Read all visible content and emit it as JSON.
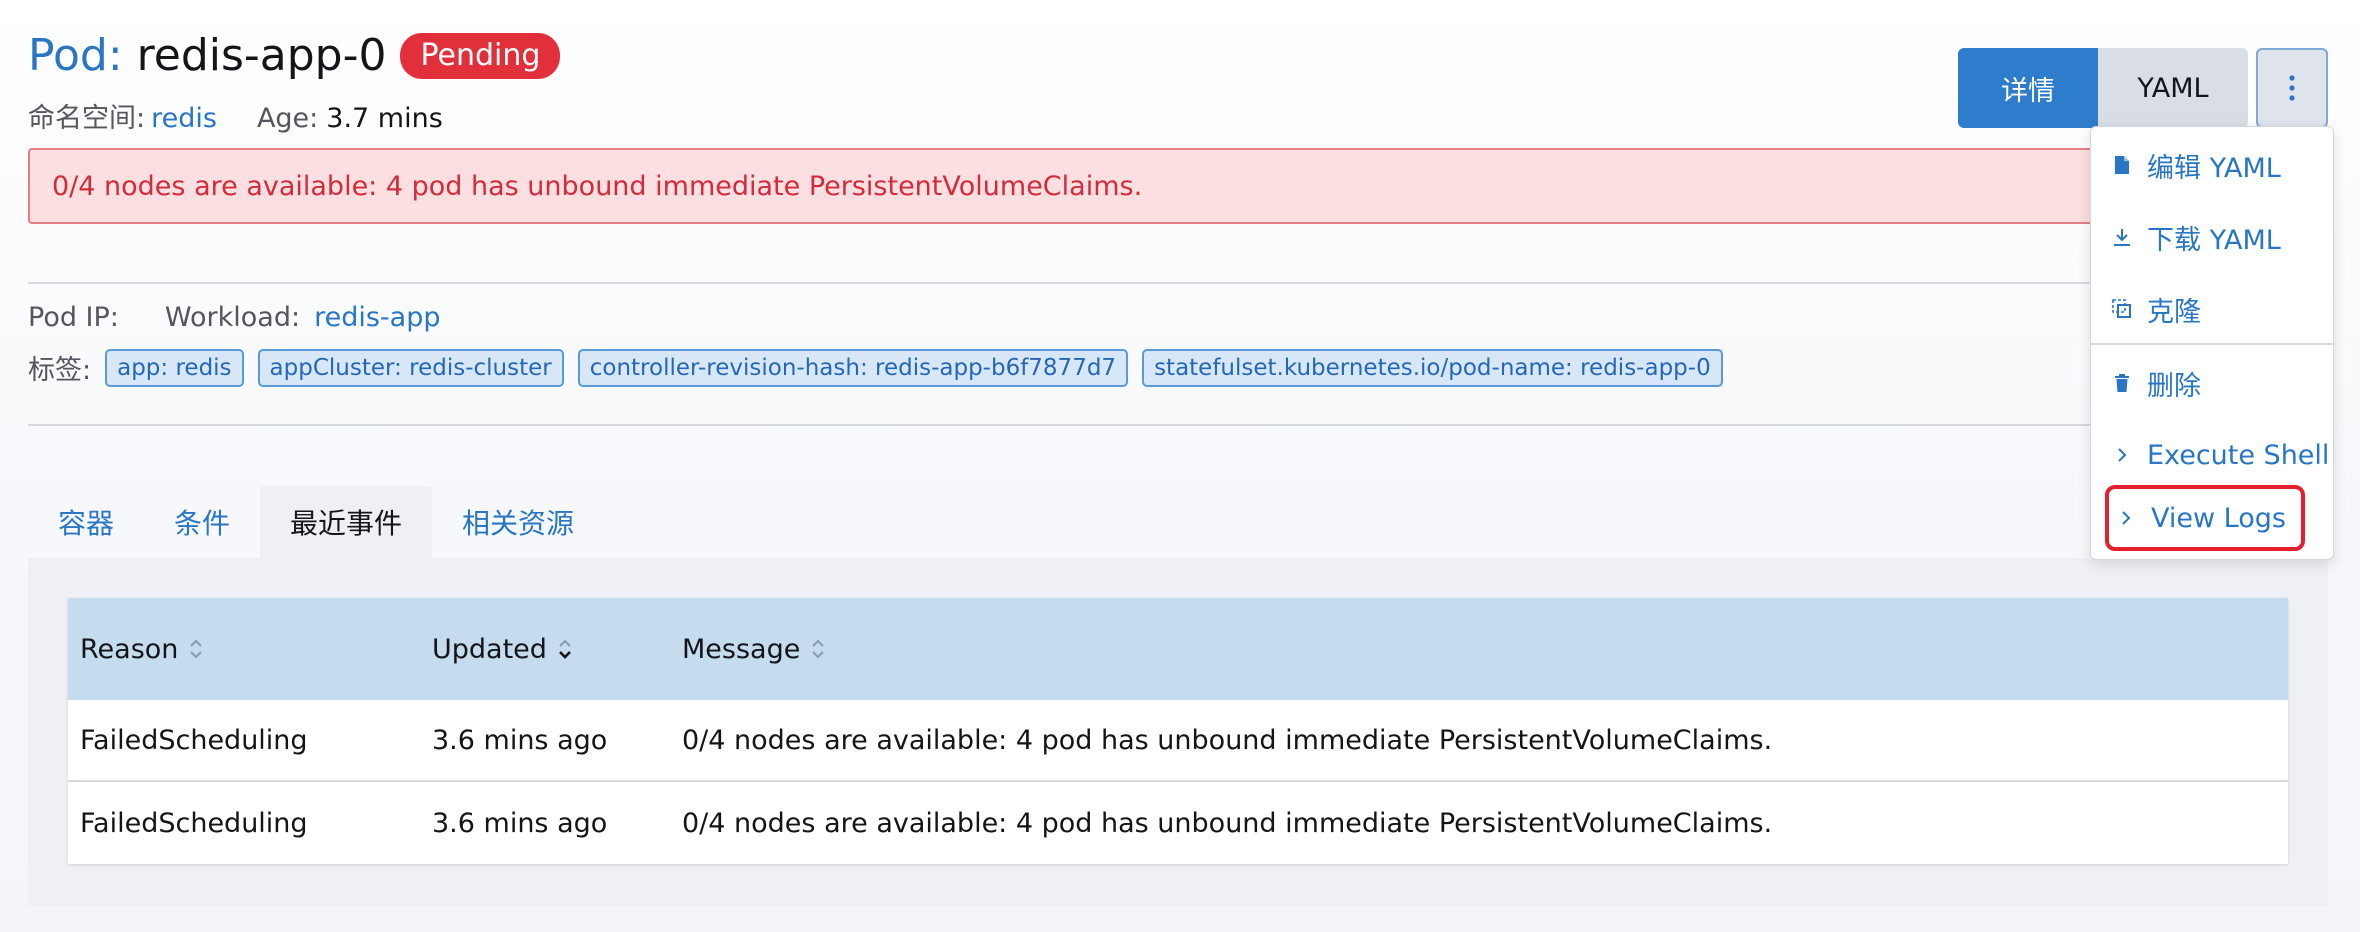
{
  "header": {
    "title_prefix": "Pod:",
    "title_name": "redis-app-0",
    "status": "Pending",
    "namespace_label": "命名空间:",
    "namespace_value": "redis",
    "age_label": "Age:",
    "age_value": "3.7 mins"
  },
  "actions": {
    "detail_label": "详情",
    "yaml_label": "YAML"
  },
  "error_banner": "0/4 nodes are available: 4 pod has unbound immediate PersistentVolumeClaims.",
  "info": {
    "pod_ip_label": "Pod IP:",
    "workload_label": "Workload:",
    "workload_value": "redis-app",
    "labels_label": "标签:",
    "tags": [
      "app: redis",
      "appCluster: redis-cluster",
      "controller-revision-hash: redis-app-b6f7877d7",
      "statefulset.kubernetes.io/pod-name: redis-app-0"
    ]
  },
  "tabs": [
    {
      "label": "容器"
    },
    {
      "label": "条件"
    },
    {
      "label": "最近事件",
      "active": true
    },
    {
      "label": "相关资源"
    }
  ],
  "events_table": {
    "headers": [
      "Reason",
      "Updated",
      "Message"
    ],
    "rows": [
      [
        "FailedScheduling",
        "3.6 mins ago",
        "0/4 nodes are available: 4 pod has unbound immediate PersistentVolumeClaims."
      ],
      [
        "FailedScheduling",
        "3.6 mins ago",
        "0/4 nodes are available: 4 pod has unbound immediate PersistentVolumeClaims."
      ]
    ]
  },
  "menu": {
    "items": [
      {
        "label": "编辑 YAML",
        "icon": "file-icon"
      },
      {
        "label": "下载 YAML",
        "icon": "download-icon"
      },
      {
        "label": "克隆",
        "icon": "clone-icon"
      },
      {
        "label": "删除",
        "icon": "trash-icon"
      },
      {
        "label": "Execute Shell",
        "icon": "chevron-right-icon"
      },
      {
        "label": "View Logs",
        "icon": "chevron-right-icon",
        "highlighted": true
      }
    ]
  },
  "colors": {
    "accent": "#2876c4",
    "status_pending": "#e2303b",
    "error_bg": "#fbdfe1",
    "table_header_bg": "#c5dbee",
    "highlight_outline": "#e4202e"
  }
}
